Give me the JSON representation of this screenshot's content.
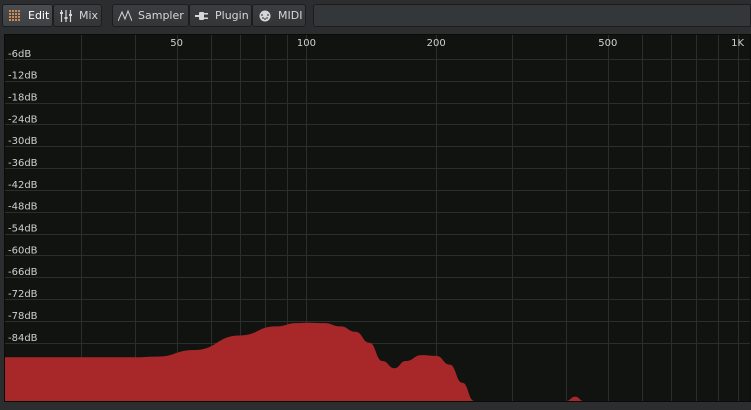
{
  "tabs": {
    "edit": {
      "label": "Edit",
      "icon": "grid-icon"
    },
    "mix": {
      "label": "Mix",
      "icon": "sliders-icon"
    },
    "sampler": {
      "label": "Sampler",
      "icon": "waveform-icon"
    },
    "plugin": {
      "label": "Plugin",
      "icon": "plug-icon"
    },
    "midi": {
      "label": "MIDI",
      "icon": "midi-port-icon"
    }
  },
  "colors": {
    "spectrum_fill": "#a8282a",
    "plot_background": "#111311",
    "grid": "#2b2e2b"
  },
  "chart_data": {
    "type": "area",
    "x_scale": "log",
    "x_tick_labels": [
      "50",
      "100",
      "200",
      "500",
      "1K"
    ],
    "x_ticks": [
      50,
      100,
      200,
      500,
      1000
    ],
    "x_minor_ticks": [
      30,
      40,
      60,
      70,
      80,
      90,
      300,
      400,
      600,
      700,
      800,
      900
    ],
    "xlim": [
      20,
      1080
    ],
    "y_tick_labels": [
      "-6dB",
      "-12dB",
      "-18dB",
      "-24dB",
      "-30dB",
      "-36dB",
      "-42dB",
      "-48dB",
      "-54dB",
      "-60dB",
      "-66dB",
      "-72dB",
      "-78dB",
      "-84dB"
    ],
    "y_ticks": [
      -6,
      -12,
      -18,
      -24,
      -30,
      -36,
      -42,
      -48,
      -54,
      -60,
      -66,
      -72,
      -78,
      -84
    ],
    "ylim": [
      -100,
      0
    ],
    "grid": true,
    "series": [
      {
        "x": [
          20,
          40,
          45,
          55,
          70,
          85,
          95,
          100,
          110,
          120,
          130,
          140,
          150,
          160,
          170,
          185,
          200,
          215,
          230,
          245,
          260,
          400,
          420,
          440,
          1080
        ],
        "y": [
          -88,
          -88,
          -87.8,
          -86,
          -82,
          -79.5,
          -78.6,
          -78.5,
          -78.6,
          -79.5,
          -81,
          -84,
          -89,
          -91,
          -89,
          -87.4,
          -87.6,
          -90,
          -95,
          -100,
          -100,
          -100,
          -98.8,
          -100,
          -100
        ]
      }
    ]
  }
}
